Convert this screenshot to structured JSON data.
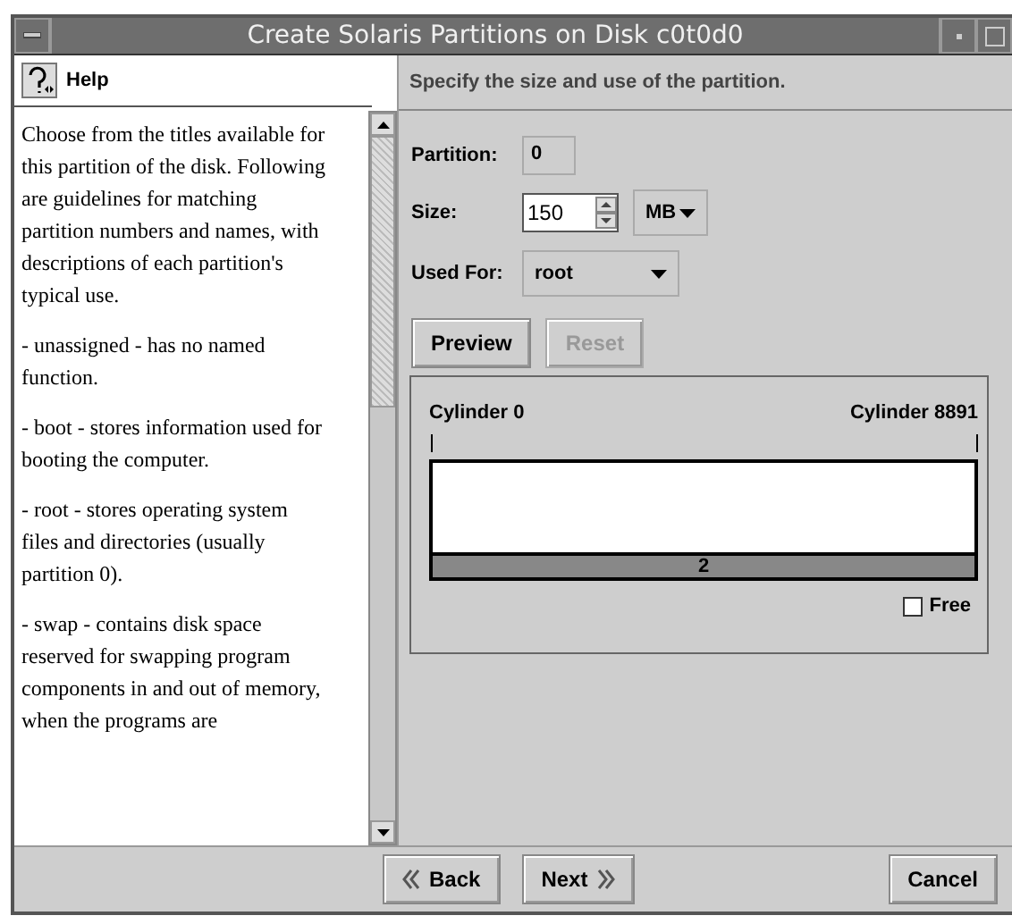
{
  "window": {
    "title": "Create Solaris Partitions on Disk c0t0d0"
  },
  "help": {
    "title": "Help",
    "paragraphs": [
      "Choose from the titles available for this partition of the disk. Following are guidelines for matching partition numbers and names, with descriptions of each partition's typical use.",
      "- unassigned - has no named function.",
      "- boot - stores information used for booting the computer.",
      "- root - stores operating system files and directories (usually partition 0).",
      "- swap - contains disk space reserved for swapping program components in and out of memory, when the programs are"
    ]
  },
  "instruction": "Specify the size and use of the partition.",
  "form": {
    "partition_label": "Partition:",
    "partition_value": "0",
    "size_label": "Size:",
    "size_value": "150",
    "size_unit": "MB",
    "used_for_label": "Used For:",
    "used_for_value": "root"
  },
  "actions": [
    {
      "label": "Preview",
      "disabled": false
    },
    {
      "label": "Reset",
      "disabled": true
    }
  ],
  "disk": {
    "start_label": "Cylinder 0",
    "end_label": "Cylinder 8891",
    "segment_label": "2",
    "free": {
      "label": "Free",
      "checked": false
    }
  },
  "buttons": [
    {
      "label": "Back",
      "kind": "back"
    },
    {
      "label": "Next",
      "kind": "next"
    },
    {
      "label": "Cancel",
      "kind": "cancel"
    }
  ]
}
